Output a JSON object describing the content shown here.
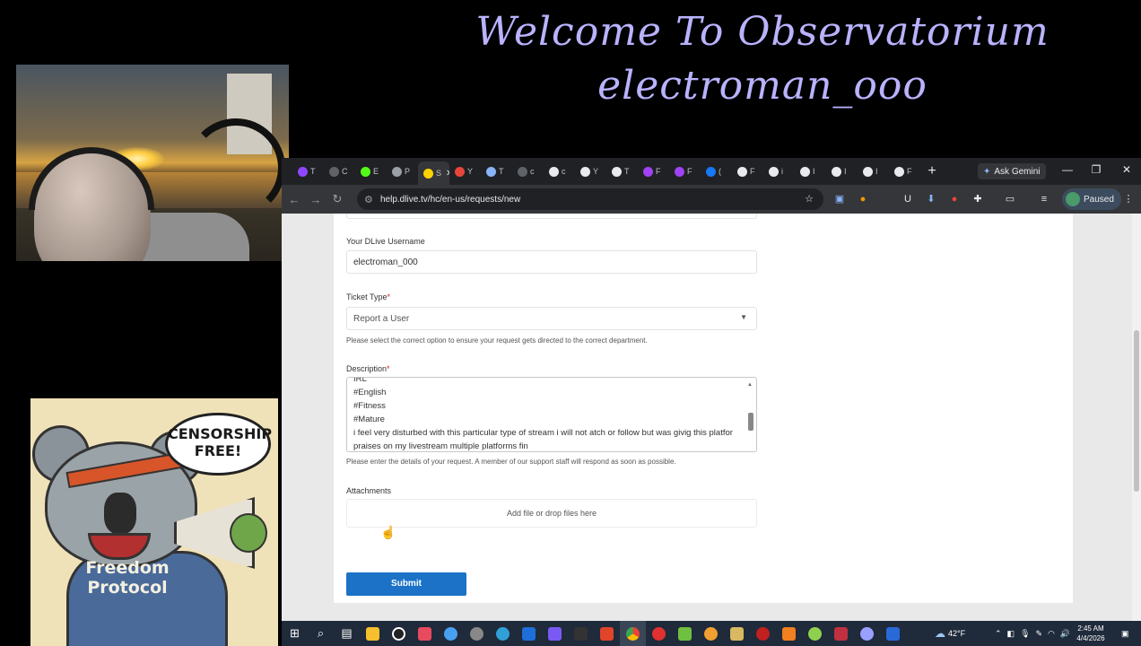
{
  "overlay": {
    "line1": "Welcome To Observatorium",
    "line2": "electroman_ooo"
  },
  "poster": {
    "bubble_line1": "CENSORSHIP",
    "bubble_line2": "FREE!",
    "hoodie_line1": "Freedom",
    "hoodie_line2": "Protocol"
  },
  "browser": {
    "tabs": [
      {
        "label": "T",
        "icon": "twitch-icon",
        "color": "#9146ff"
      },
      {
        "label": "C",
        "icon": "circle-icon",
        "color": "#5f6368"
      },
      {
        "label": "E",
        "icon": "kick-icon",
        "color": "#53fc18"
      },
      {
        "label": "P",
        "icon": "page-icon",
        "color": "#9aa0a6"
      },
      {
        "label": "S",
        "icon": "dlive-icon",
        "color": "#ffd300"
      },
      {
        "label": "Y",
        "icon": "record-icon",
        "color": "#e8453c"
      },
      {
        "label": "T",
        "icon": "tab-icon",
        "color": "#8ab4f8"
      },
      {
        "label": "c",
        "icon": "link-icon",
        "color": "#5f6368"
      },
      {
        "label": "c",
        "icon": "google-icon",
        "color": "#e8eaed"
      },
      {
        "label": "Y",
        "icon": "google-icon",
        "color": "#e8eaed"
      },
      {
        "label": "T",
        "icon": "github-icon",
        "color": "#e8eaed"
      },
      {
        "label": "F",
        "icon": "m-icon",
        "color": "#a142f4"
      },
      {
        "label": "F",
        "icon": "m-icon",
        "color": "#a142f4"
      },
      {
        "label": "(",
        "icon": "facebook-icon",
        "color": "#1877f2"
      },
      {
        "label": "F",
        "icon": "github-icon",
        "color": "#e8eaed"
      },
      {
        "label": "i",
        "icon": "google-icon",
        "color": "#e8eaed"
      },
      {
        "label": "I",
        "icon": "google-icon",
        "color": "#e8eaed"
      },
      {
        "label": "I",
        "icon": "github-icon",
        "color": "#e8eaed"
      },
      {
        "label": "I",
        "icon": "google-icon",
        "color": "#e8eaed"
      },
      {
        "label": "F",
        "icon": "page-icon",
        "color": "#e8eaed"
      }
    ],
    "active_tab_label": "S",
    "ask_gemini": "Ask Gemini",
    "url": "help.dlive.tv/hc/en-us/requests/new",
    "profile_label": "Paused"
  },
  "form": {
    "username_label": "Your DLive Username",
    "username_value": "electroman_000",
    "ticket_type_label": "Ticket Type",
    "ticket_type_value": "Report a User",
    "ticket_hint": "Please select the correct option to ensure your request gets directed to the correct department.",
    "description_label": "Description",
    "description_lines": [
      "IRL",
      "#English",
      "#Fitness",
      "#Mature"
    ],
    "description_wrap": "i feel very disturbed with this particular type of stream i will not atch or follow but was givig this platfor praises on my livestream multiple platforms fin",
    "description_hint": "Please enter the details of your request. A member of our support staff will respond as soon as possible.",
    "attachments_label": "Attachments",
    "dropzone_text": "Add file or drop files here",
    "submit_label": "Submit",
    "required_marker": "*"
  },
  "taskbar": {
    "weather": "42°F",
    "time": "2:45 AM",
    "date": "4/4/2026"
  }
}
